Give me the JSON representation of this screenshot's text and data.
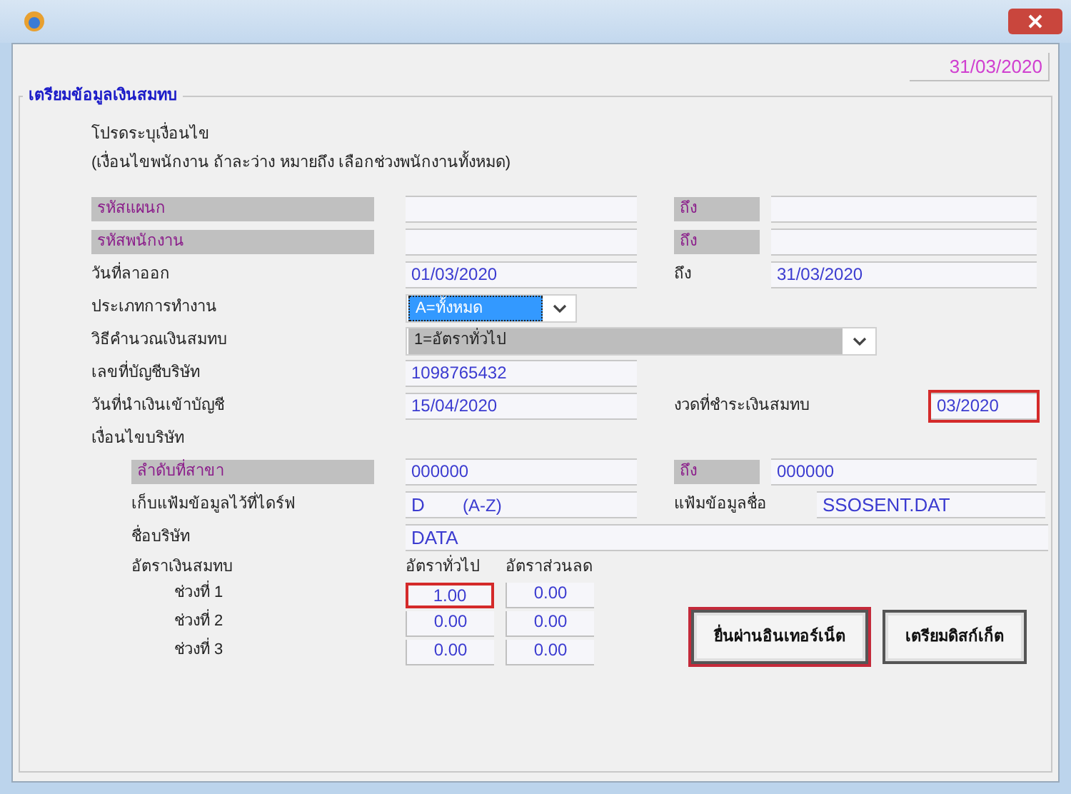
{
  "header_date": "31/03/2020",
  "group": {
    "title": "เตรียมข้อมูลเงินสมทบ",
    "instruction": "โปรดระบุเงื่อนไข",
    "note": "(เงื่อนไขพนักงาน ถ้าละว่าง หมายถึง เลือกช่วงพนักงานทั้งหมด)"
  },
  "rows": [
    {
      "label": "รหัสแผนก",
      "shaded": true,
      "field": {
        "kind": "text"
      },
      "to": {
        "label": "ถึง",
        "shaded": true,
        "field": {
          "kind": "text"
        }
      }
    },
    {
      "label": "รหัสพนักงาน",
      "shaded": true,
      "field": {
        "kind": "text"
      },
      "to": {
        "label": "ถึง",
        "shaded": true,
        "field": {
          "kind": "text"
        }
      }
    },
    {
      "label": "วันที่ลาออก",
      "shaded": false,
      "field": {
        "kind": "text",
        "value": "01/03/2020"
      },
      "to": {
        "label": "ถึง",
        "shaded": false,
        "field": {
          "kind": "text",
          "value": "31/03/2020"
        }
      }
    },
    {
      "label": "ประเภทการทำงาน",
      "shaded": false,
      "field": {
        "kind": "dropdown",
        "value": "A=ทั้งหมด",
        "focused": true
      }
    },
    {
      "label": "วิธีคำนวณเงินสมทบ",
      "shaded": false,
      "field": {
        "kind": "wide-dropdown",
        "value": "1=อัตราทั่วไป",
        "focused": false
      }
    },
    {
      "label": "เลขที่บัญชีบริษัท",
      "shaded": false,
      "field": {
        "kind": "text",
        "value": "1098765432"
      }
    },
    {
      "label": "วันที่นำเงินเข้าบัญชี",
      "shaded": false,
      "field": {
        "kind": "text",
        "value": "15/04/2020"
      },
      "aside": {
        "label": "งวดที่ชำระเงินสมทบ",
        "field": {
          "kind": "short",
          "value": "03/2020",
          "highlighted": true
        }
      }
    }
  ],
  "company": {
    "label": "เงื่อนไขบริษัท",
    "children": [
      {
        "label": "ลำดับที่สาขา",
        "shaded": true,
        "field": {
          "kind": "text",
          "value": "000000"
        },
        "to": {
          "label": "ถึง",
          "shaded": true,
          "field": {
            "kind": "text",
            "value": "000000"
          }
        }
      },
      {
        "label": "เก็บแฟ้มข้อมูลไว้ที่ไดร์ฟ",
        "shaded": false,
        "field": {
          "kind": "drive",
          "value": "D",
          "suffix": "(A-Z)"
        },
        "aside": {
          "label": "แฟ้มข้อมูลชื่อ",
          "field": {
            "kind": "file",
            "value": "SSOSENT.DAT",
            "highlighted": false
          }
        }
      },
      {
        "label": "ชื่อบริษัท",
        "shaded": false,
        "field": {
          "kind": "full",
          "value": "DATA"
        }
      }
    ]
  },
  "rates": {
    "label": "อัตราเงินสมทบ",
    "columns": [
      "อัตราทั่วไป",
      "อัตราส่วนลด"
    ],
    "rows": [
      {
        "label": "ช่วงที่ 1",
        "cells": [
          {
            "value": "1.00",
            "highlighted": true
          },
          {
            "value": "0.00",
            "highlighted": false
          }
        ]
      },
      {
        "label": "ช่วงที่ 2",
        "cells": [
          {
            "value": "0.00",
            "highlighted": false
          },
          {
            "value": "0.00",
            "highlighted": false
          }
        ]
      },
      {
        "label": "ช่วงที่ 3",
        "cells": [
          {
            "value": "0.00",
            "highlighted": false
          },
          {
            "value": "0.00",
            "highlighted": false
          }
        ]
      }
    ]
  },
  "buttons": [
    {
      "label": "ยื่นผ่านอินเทอร์เน็ต",
      "highlighted": true
    },
    {
      "label": "เตรียมดิสก์เก็ต",
      "highlighted": false
    }
  ]
}
